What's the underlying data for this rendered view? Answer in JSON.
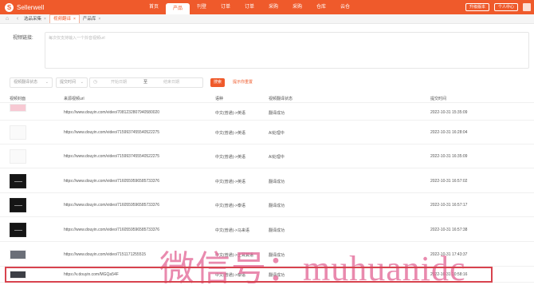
{
  "header": {
    "brand": "Sellerwell",
    "nav": [
      "首页",
      "产品",
      "刊登",
      "订单",
      "订单",
      "采购",
      "采购",
      "仓库",
      "云仓"
    ],
    "active_index": 1,
    "actions": [
      "升级版本",
      "个人中心"
    ]
  },
  "tabs": [
    {
      "label": "选品采集",
      "active": false
    },
    {
      "label": "视频翻译",
      "active": true
    },
    {
      "label": "产品库",
      "active": false
    }
  ],
  "url_input": {
    "label": "视频链接:",
    "placeholder": "每次仅支持输入一个抖音视频url"
  },
  "filters": {
    "status_select": "视频翻译状态",
    "time_select": "提交时间",
    "start_placeholder": "开始日期",
    "to": "至",
    "end_placeholder": "结束日期",
    "search": "搜索",
    "reset": "提示你重置"
  },
  "table": {
    "columns": [
      "视频封面",
      "来源视频url",
      "语种",
      "视频翻译状态",
      "提交时间"
    ],
    "rows": [
      {
        "thumb": "pink",
        "url": "https://www.douyin.com/video/7081232807940580020",
        "lang": "中文(普通)->英语",
        "status": "翻译成功",
        "time": "2022-10-31 15:35:09"
      },
      {
        "thumb": "blank",
        "url": "https://www.douyin.com/video/7159937455540522275",
        "lang": "中文(普通)->英语",
        "status": "AI处理中",
        "time": "2022-10-31 16:28:04"
      },
      {
        "thumb": "blank",
        "url": "https://www.douyin.com/video/7159937455540522275",
        "lang": "中文(普通)->英语",
        "status": "AI处理中",
        "time": "2022-10-31 16:35:09"
      },
      {
        "thumb": "dark",
        "url": "https://www.douyin.com/video/7160559596585733376",
        "lang": "中文(普通)->英语",
        "status": "翻译成功",
        "time": "2022-10-31 16:57:02"
      },
      {
        "thumb": "dark",
        "url": "https://www.douyin.com/video/7160559596585733376",
        "lang": "中文(普通)->泰语",
        "status": "翻译成功",
        "time": "2022-10-31 16:57:17"
      },
      {
        "thumb": "dark",
        "url": "https://www.douyin.com/video/7160559596585733376",
        "lang": "中文(普通)->马来语",
        "status": "翻译成功",
        "time": "2022-10-31 16:57:38"
      },
      {
        "thumb": "photo",
        "url": "https://www.douyin.com/video/7151171255515",
        "lang": "中文(普通)->土耳其语",
        "status": "翻译成功",
        "time": "2022-10-31 17:43:37"
      },
      {
        "thumb": "photo2",
        "url": "https://v.douyin.com/MGQa54F",
        "lang": "中文(普通)->泰语",
        "status": "翻译成功",
        "time": "2022-10-31 20:58:16"
      }
    ]
  },
  "watermark": "微信号：muhuanidc"
}
